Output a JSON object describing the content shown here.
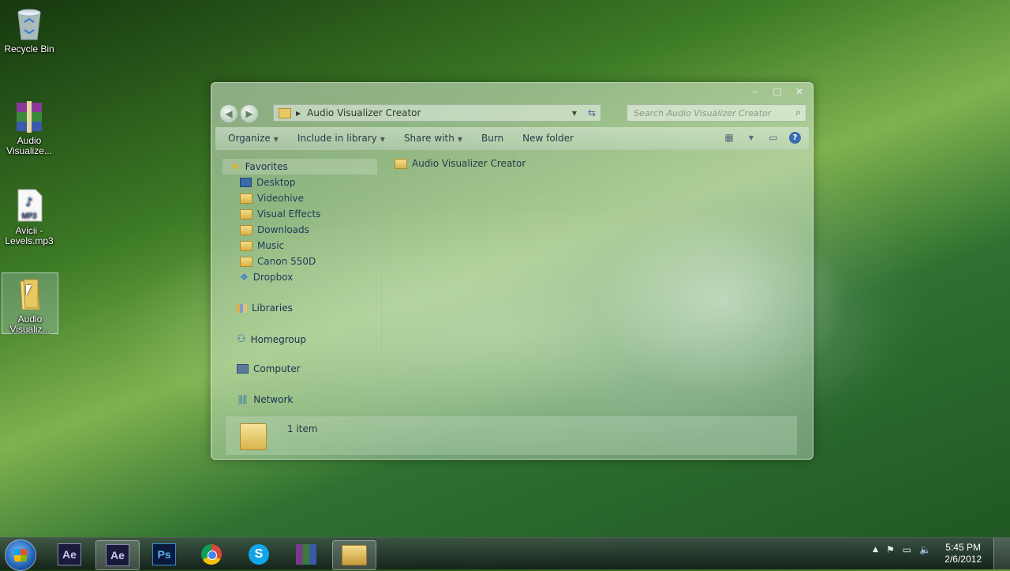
{
  "desktop": {
    "icons": [
      {
        "label": "Recycle Bin",
        "icon": "recycle-bin-icon"
      },
      {
        "label": "Audio Visualize...",
        "icon": "winrar-archive-icon"
      },
      {
        "label": "Avicii - Levels.mp3",
        "icon": "mp3-file-icon",
        "badge": "MP3"
      },
      {
        "label": "Audio Visualiz...",
        "icon": "folder-icon"
      }
    ]
  },
  "window": {
    "address": {
      "path": "Audio Visualizer Creator"
    },
    "search": {
      "placeholder": "Search Audio Visualizer Creator"
    },
    "toolbar": {
      "organize": "Organize",
      "include_in_library": "Include in library",
      "share_with": "Share with",
      "burn": "Burn",
      "new_folder": "New folder"
    },
    "nav": {
      "favorites": "Favorites",
      "favorites_items": [
        "Desktop",
        "Videohive",
        "Visual Effects",
        "Downloads",
        "Music",
        "Canon 550D",
        "Dropbox"
      ],
      "libraries": "Libraries",
      "homegroup": "Homegroup",
      "computer": "Computer",
      "network": "Network"
    },
    "content": {
      "items": [
        "Audio Visualizer Creator"
      ]
    },
    "details": {
      "count": "1 item"
    }
  },
  "taskbar": {
    "apps": [
      "after-effects-icon",
      "after-effects-icon",
      "photoshop-icon",
      "chrome-icon",
      "skype-icon",
      "winrar-icon",
      "windows-explorer-icon"
    ],
    "ae_label": "Ae",
    "ps_label": "Ps",
    "skype_label": "S",
    "clock": {
      "time": "5:45 PM",
      "date": "2/6/2012"
    }
  }
}
